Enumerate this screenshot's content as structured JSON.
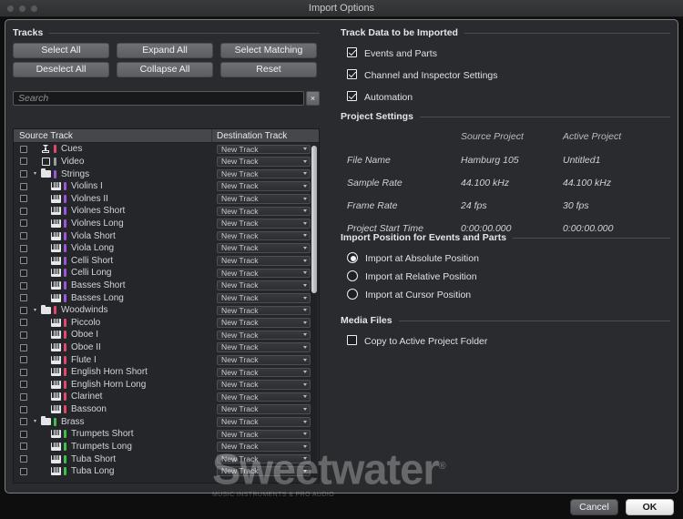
{
  "window": {
    "title": "Import Options",
    "traffic_lights": [
      "close",
      "minimize",
      "zoom"
    ]
  },
  "tracks_panel": {
    "section_label": "Tracks",
    "buttons": [
      {
        "id": "select-all",
        "label": "Select All"
      },
      {
        "id": "expand-all",
        "label": "Expand All"
      },
      {
        "id": "select-matching",
        "label": "Select Matching"
      },
      {
        "id": "deselect-all",
        "label": "Deselect All"
      },
      {
        "id": "collapse-all",
        "label": "Collapse All"
      },
      {
        "id": "reset",
        "label": "Reset"
      }
    ],
    "search": {
      "value": "",
      "placeholder": "Search",
      "clear_icon": "close-icon",
      "clear_label": "×"
    },
    "columns": {
      "source": "Source Track",
      "destination": "Destination Track"
    },
    "destination_default": "New Track",
    "rows": [
      {
        "name": "Cues",
        "indent": 0,
        "icon": "cue-marker-icon",
        "color": "#e0486e",
        "disclosure": "",
        "checked": false,
        "destination": "New Track"
      },
      {
        "name": "Video",
        "indent": 0,
        "icon": "video-icon",
        "color": "#9a9ca0",
        "disclosure": "",
        "checked": false,
        "destination": "New Track"
      },
      {
        "name": "Strings",
        "indent": 0,
        "icon": "folder-icon",
        "color": "#9b55d6",
        "disclosure": "▾",
        "checked": false,
        "destination": "New Track"
      },
      {
        "name": "Violins I",
        "indent": 1,
        "icon": "piano-icon",
        "color": "#9b55d6",
        "disclosure": "",
        "checked": false,
        "destination": "New Track"
      },
      {
        "name": "Violnes II",
        "indent": 1,
        "icon": "piano-icon",
        "color": "#9b55d6",
        "disclosure": "",
        "checked": false,
        "destination": "New Track"
      },
      {
        "name": "Violnes Short",
        "indent": 1,
        "icon": "piano-icon",
        "color": "#9b55d6",
        "disclosure": "",
        "checked": false,
        "destination": "New Track"
      },
      {
        "name": "Violnes Long",
        "indent": 1,
        "icon": "piano-icon",
        "color": "#9b55d6",
        "disclosure": "",
        "checked": false,
        "destination": "New Track"
      },
      {
        "name": "Viola Short",
        "indent": 1,
        "icon": "piano-icon",
        "color": "#9b55d6",
        "disclosure": "",
        "checked": false,
        "destination": "New Track"
      },
      {
        "name": "Viola Long",
        "indent": 1,
        "icon": "piano-icon",
        "color": "#9b55d6",
        "disclosure": "",
        "checked": false,
        "destination": "New Track"
      },
      {
        "name": "Celli Short",
        "indent": 1,
        "icon": "piano-icon",
        "color": "#9b55d6",
        "disclosure": "",
        "checked": false,
        "destination": "New Track"
      },
      {
        "name": "Celli Long",
        "indent": 1,
        "icon": "piano-icon",
        "color": "#9b55d6",
        "disclosure": "",
        "checked": false,
        "destination": "New Track"
      },
      {
        "name": "Basses Short",
        "indent": 1,
        "icon": "piano-icon",
        "color": "#9b55d6",
        "disclosure": "",
        "checked": false,
        "destination": "New Track"
      },
      {
        "name": "Basses Long",
        "indent": 1,
        "icon": "piano-icon",
        "color": "#9b55d6",
        "disclosure": "",
        "checked": false,
        "destination": "New Track"
      },
      {
        "name": "Woodwinds",
        "indent": 0,
        "icon": "folder-icon",
        "color": "#e0486e",
        "disclosure": "▾",
        "checked": false,
        "destination": "New Track"
      },
      {
        "name": "Piccolo",
        "indent": 1,
        "icon": "piano-icon",
        "color": "#e0486e",
        "disclosure": "",
        "checked": false,
        "destination": "New Track"
      },
      {
        "name": "Oboe I",
        "indent": 1,
        "icon": "piano-icon",
        "color": "#e0486e",
        "disclosure": "",
        "checked": false,
        "destination": "New Track"
      },
      {
        "name": "Oboe II",
        "indent": 1,
        "icon": "piano-icon",
        "color": "#e0486e",
        "disclosure": "",
        "checked": false,
        "destination": "New Track"
      },
      {
        "name": "Flute I",
        "indent": 1,
        "icon": "piano-icon",
        "color": "#e0486e",
        "disclosure": "",
        "checked": false,
        "destination": "New Track"
      },
      {
        "name": "English Horn Short",
        "indent": 1,
        "icon": "piano-icon",
        "color": "#e0486e",
        "disclosure": "",
        "checked": false,
        "destination": "New Track"
      },
      {
        "name": "English Horn Long",
        "indent": 1,
        "icon": "piano-icon",
        "color": "#e0486e",
        "disclosure": "",
        "checked": false,
        "destination": "New Track"
      },
      {
        "name": "Clarinet",
        "indent": 1,
        "icon": "piano-icon",
        "color": "#e0486e",
        "disclosure": "",
        "checked": false,
        "destination": "New Track"
      },
      {
        "name": "Bassoon",
        "indent": 1,
        "icon": "piano-icon",
        "color": "#e0486e",
        "disclosure": "",
        "checked": false,
        "destination": "New Track"
      },
      {
        "name": "Brass",
        "indent": 0,
        "icon": "folder-icon",
        "color": "#3fbf4a",
        "disclosure": "▾",
        "checked": false,
        "destination": "New Track"
      },
      {
        "name": "Trumpets Short",
        "indent": 1,
        "icon": "piano-icon",
        "color": "#3fbf4a",
        "disclosure": "",
        "checked": false,
        "destination": "New Track"
      },
      {
        "name": "Trumpets Long",
        "indent": 1,
        "icon": "piano-icon",
        "color": "#3fbf4a",
        "disclosure": "",
        "checked": false,
        "destination": "New Track"
      },
      {
        "name": "Tuba Short",
        "indent": 1,
        "icon": "piano-icon",
        "color": "#3fbf4a",
        "disclosure": "",
        "checked": false,
        "destination": "New Track"
      },
      {
        "name": "Tuba Long",
        "indent": 1,
        "icon": "piano-icon",
        "color": "#3fbf4a",
        "disclosure": "",
        "checked": false,
        "destination": "New Track"
      }
    ]
  },
  "track_data": {
    "section_label": "Track Data to be Imported",
    "items": [
      {
        "id": "events-and-parts",
        "label": "Events and Parts",
        "checked": true
      },
      {
        "id": "channel-inspector-settings",
        "label": "Channel and Inspector Settings",
        "checked": true
      },
      {
        "id": "automation",
        "label": "Automation",
        "checked": true
      }
    ]
  },
  "project_settings": {
    "section_label": "Project Settings",
    "col_source": "Source Project",
    "col_active": "Active Project",
    "rows": [
      {
        "label": "File Name",
        "source": "Hamburg 105",
        "active": "Untitled1"
      },
      {
        "label": "Sample Rate",
        "source": "44.100 kHz",
        "active": "44.100 kHz"
      },
      {
        "label": "Frame Rate",
        "source": "24 fps",
        "active": "30 fps"
      },
      {
        "label": "Project Start Time",
        "source": "0:00:00.000",
        "active": "0:00:00.000"
      }
    ]
  },
  "import_position": {
    "section_label": "Import Position for Events and Parts",
    "options": [
      {
        "id": "absolute",
        "label": "Import at Absolute Position",
        "selected": true
      },
      {
        "id": "relative",
        "label": "Import at Relative Position",
        "selected": false
      },
      {
        "id": "cursor",
        "label": "Import at Cursor Position",
        "selected": false
      }
    ]
  },
  "media_files": {
    "section_label": "Media Files",
    "items": [
      {
        "id": "copy-to-active-project-folder",
        "label": "Copy to Active Project Folder",
        "checked": false
      }
    ]
  },
  "footer": {
    "cancel_label": "Cancel",
    "ok_label": "OK"
  },
  "watermark": {
    "brand": "Sweetwater",
    "registered": "®",
    "tagline": "MUSIC INSTRUMENTS & PRO AUDIO"
  },
  "colors": {
    "dialog_bg": "#2a2b2e",
    "list_bg": "#252629",
    "accent_strings": "#9b55d6",
    "accent_woodwinds": "#e0486e",
    "accent_brass": "#3fbf4a",
    "accent_cues": "#e0486e",
    "accent_video": "#9a9ca0"
  }
}
